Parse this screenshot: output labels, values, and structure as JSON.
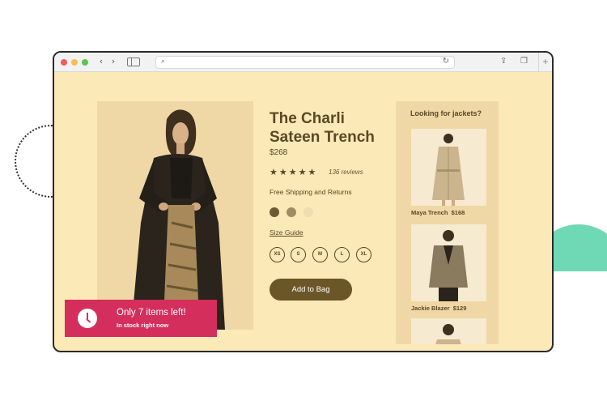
{
  "product": {
    "title": "The Charli Sateen Trench",
    "price": "$268",
    "rating_stars": "★★★★★",
    "rating": 5,
    "reviews": "136 reviews",
    "shipping": "Free Shipping and Returns",
    "swatches": [
      "#6b5a33",
      "#a08d63",
      "#efdcb0"
    ],
    "size_guide": "Size Guide",
    "sizes": [
      "XS",
      "S",
      "M",
      "L",
      "XL"
    ],
    "add_to_bag": "Add to Bag"
  },
  "recommendations": {
    "heading": "Looking for jackets?",
    "items": [
      {
        "name": "Maya Trench",
        "price": "$168"
      },
      {
        "name": "Jackie Blazer",
        "price": "$129"
      }
    ]
  },
  "stock_alert": {
    "headline": "Only 7 items left!",
    "subtext": "In stock right now"
  },
  "icons": {
    "back": "‹",
    "forward": "›",
    "search": "⌕",
    "reload": "↻",
    "share": "⇪",
    "tabs": "❐",
    "new_tab": "+"
  },
  "colors": {
    "page_tint": "#fbe9b7",
    "accent_pink": "#d42e5c",
    "button_brown": "#6b5628",
    "decor_teal": "#6fd9b6"
  }
}
